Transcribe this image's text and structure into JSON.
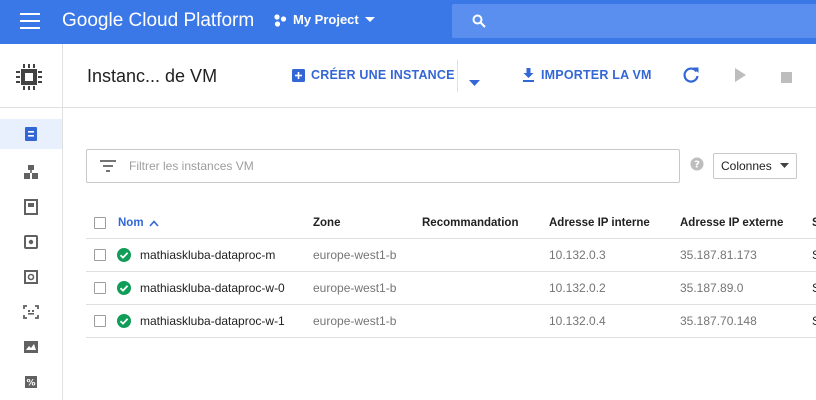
{
  "topbar": {
    "brand": "Google Cloud Platform",
    "project_name": "My Project",
    "search_placeholder": ""
  },
  "toolbar": {
    "title": "Instanc... de VM",
    "create_label": "CRÉER UNE INSTANCE",
    "import_label": "IMPORTER LA VM"
  },
  "filter": {
    "placeholder": "Filtrer les instances VM",
    "columns_label": "Colonnes"
  },
  "table": {
    "columns": {
      "name": "Nom",
      "zone": "Zone",
      "recommendation": "Recommandation",
      "internal_ip": "Adresse IP interne",
      "external_ip": "Adresse IP externe"
    },
    "rows": [
      {
        "name": "mathiaskluba-dataproc-m",
        "zone": "europe-west1-b",
        "recommendation": "",
        "internal_ip": "10.132.0.3",
        "external_ip": "35.187.81.173",
        "status": "running"
      },
      {
        "name": "mathiaskluba-dataproc-w-0",
        "zone": "europe-west1-b",
        "recommendation": "",
        "internal_ip": "10.132.0.2",
        "external_ip": "35.187.89.0",
        "status": "running"
      },
      {
        "name": "mathiaskluba-dataproc-w-1",
        "zone": "europe-west1-b",
        "recommendation": "",
        "internal_ip": "10.132.0.4",
        "external_ip": "35.187.70.148",
        "status": "running"
      }
    ]
  },
  "colors": {
    "topbar": "#3b78e7",
    "accent": "#3367d6",
    "status_ok": "#0f9d58"
  },
  "icons": {
    "sidebar": [
      "vm-instances-icon",
      "instance-groups-icon",
      "instance-templates-icon",
      "disks-icon",
      "snapshots-icon",
      "images-icon",
      "tpu-icon",
      "committed-use-icon"
    ]
  }
}
